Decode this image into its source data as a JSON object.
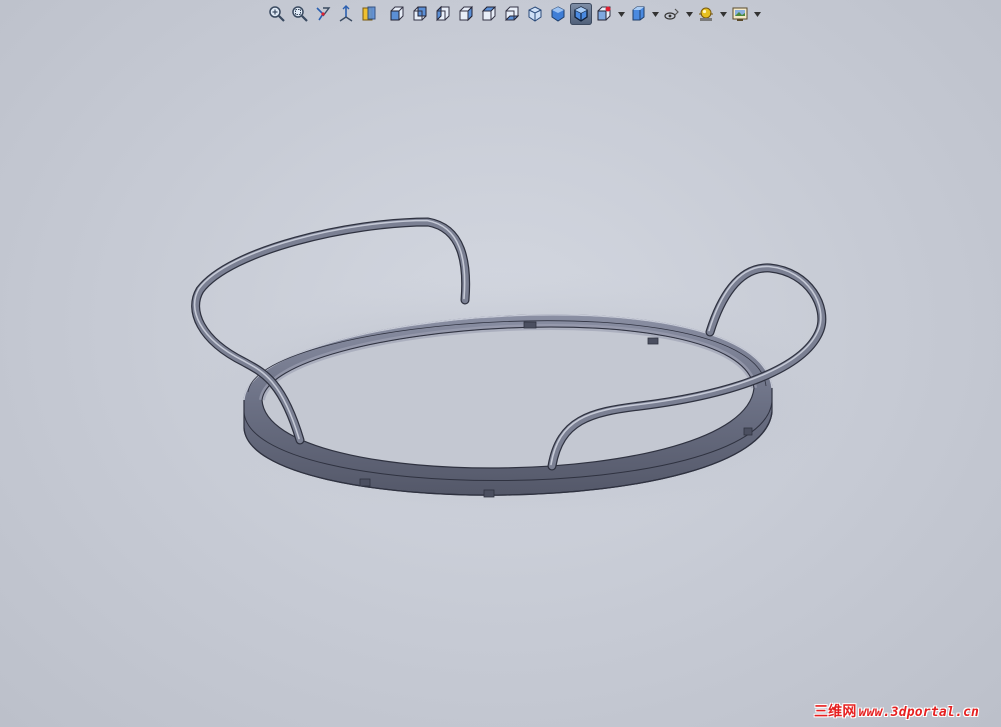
{
  "viewport": {
    "background_top": "#d3d7e0",
    "background_bottom": "#bcc0ca"
  },
  "toolbar": {
    "items": [
      {
        "icon": "zoom-to-fit-icon",
        "type": "button"
      },
      {
        "icon": "zoom-to-area-icon",
        "type": "button"
      },
      {
        "icon": "previous-view-icon",
        "type": "button"
      },
      {
        "icon": "3d-drawing-view-icon",
        "type": "button"
      },
      {
        "icon": "section-view-icon",
        "type": "button"
      },
      {
        "icon": "view-front-icon",
        "type": "button"
      },
      {
        "icon": "view-back-icon",
        "type": "button"
      },
      {
        "icon": "view-left-icon",
        "type": "button"
      },
      {
        "icon": "view-right-icon",
        "type": "button"
      },
      {
        "icon": "view-top-icon",
        "type": "button"
      },
      {
        "icon": "view-bottom-icon",
        "type": "button"
      },
      {
        "icon": "isometric-view-icon",
        "type": "button"
      },
      {
        "icon": "shaded-view-icon",
        "type": "button"
      },
      {
        "icon": "shaded-with-edges-icon",
        "type": "button",
        "active": true
      },
      {
        "icon": "view-orientation-icon",
        "type": "dropdown"
      },
      {
        "icon": "display-style-icon",
        "type": "dropdown"
      },
      {
        "icon": "hide-show-items-icon",
        "type": "dropdown"
      },
      {
        "icon": "edit-appearance-icon",
        "type": "dropdown"
      },
      {
        "icon": "apply-scene-icon",
        "type": "dropdown"
      }
    ],
    "active_color": "#4f5f78"
  },
  "model": {
    "description_name": "ring-tray-with-handles",
    "body_color": "#6e7386",
    "edge_color": "#2f3240",
    "highlight_color": "#c5c9d6"
  },
  "watermark": {
    "cn": "三维网",
    "url": "www.3dportal.cn",
    "color": "#e62020"
  }
}
